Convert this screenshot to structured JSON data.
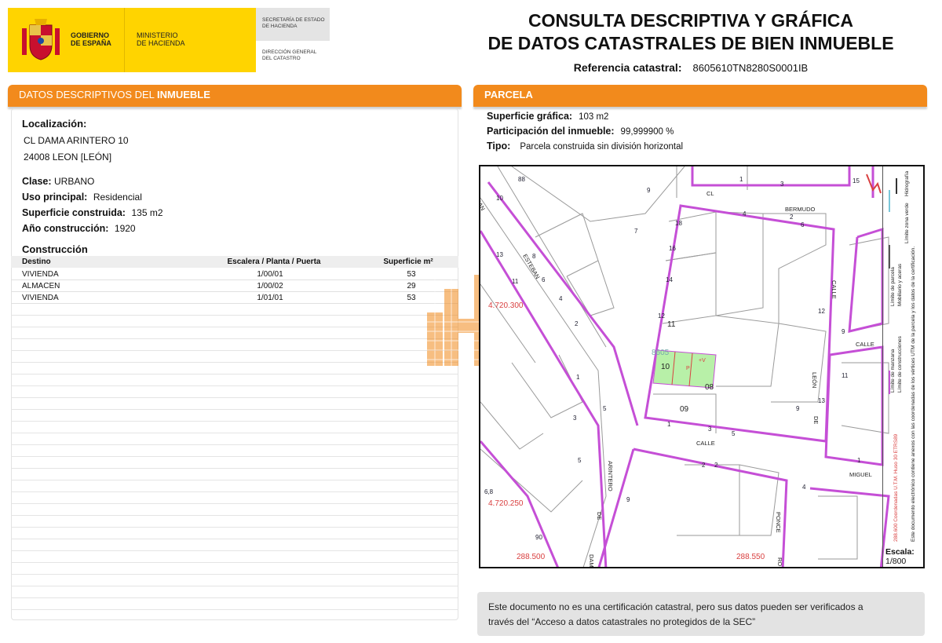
{
  "header": {
    "gobierno": [
      "GOBIERNO",
      "DE ESPAÑA"
    ],
    "ministerio": [
      "MINISTERIO",
      "DE HACIENDA"
    ],
    "secretaria": [
      "SECRETARÍA DE ESTADO",
      "DE HACIENDA"
    ],
    "direccion": [
      "DIRECCIÓN GENERAL",
      "DEL CATASTRO"
    ],
    "title_line1": "CONSULTA DESCRIPTIVA Y GRÁFICA",
    "title_line2": "DE DATOS CATASTRALES DE BIEN INMUEBLE",
    "ref_label": "Referencia catastral:",
    "ref_value": "8605610TN8280S0001IB"
  },
  "left": {
    "section_title_a": "DATOS DESCRIPTIVOS DEL ",
    "section_title_b": "INMUEBLE",
    "localizacion_label": "Localización:",
    "address_line1": "CL DAMA ARINTERO 10",
    "address_line2": "24008 LEON [LEÓN]",
    "clase_label": "Clase:",
    "clase_value": "URBANO",
    "uso_label": "Uso principal:",
    "uso_value": "Residencial",
    "superficie_label": "Superficie construida:",
    "superficie_value": "135 m2",
    "anio_label": "Año construcción:",
    "anio_value": "1920",
    "construccion_label": "Construcción",
    "table_headers": [
      "Destino",
      "Escalera / Planta / Puerta",
      "Superficie m²"
    ],
    "rows": [
      [
        "VIVIENDA",
        "1/00/01",
        "53"
      ],
      [
        "ALMACEN",
        "1/00/02",
        "29"
      ],
      [
        "VIVIENDA",
        "1/01/01",
        "53"
      ]
    ]
  },
  "right": {
    "section_title": "PARCELA",
    "superficie_grafica_label": "Superficie gráfica:",
    "superficie_grafica_value": "103 m2",
    "participacion_label": "Participación del inmueble:",
    "participacion_value": "99,999900 %",
    "tipo_label": "Tipo:",
    "tipo_value": "Parcela construida sin división horizontal",
    "escala_label": "Escala:",
    "escala_value": "1/800",
    "notice_line1": "Este documento no es una certificación catastral, pero sus datos pueden ser verificados a",
    "notice_line2": "través del “Acceso a datos catastrales no protegidos de la SEC”"
  },
  "map": {
    "coord_labels": [
      "4.720.300",
      "4.720.250",
      "288.500",
      "288.550"
    ],
    "street_labels": [
      "CL",
      "BERMUDO",
      "CALLE",
      "CALLE",
      "LEÓN",
      "DE",
      "CALLE",
      "MIGUEL",
      "ESTEBAN",
      "SAN",
      "ARINTERO",
      "DE",
      "DAMA",
      "PONCE",
      "RO"
    ],
    "parcel_labels": [
      "11",
      "10",
      "08",
      "09",
      "8605",
      "P",
      "+V"
    ],
    "vertex_numbers": [
      "1",
      "3",
      "5",
      "4",
      "6",
      "18",
      "16",
      "14",
      "12",
      "9",
      "7",
      "5",
      "3",
      "1",
      "2",
      "4",
      "6",
      "8",
      "10",
      "11",
      "13",
      "12",
      "9",
      "13",
      "11",
      "9",
      "15",
      "2",
      "4",
      "1",
      "3",
      "5",
      "2",
      "1",
      "9",
      "6,8",
      "90",
      "88",
      "2"
    ],
    "legend": [
      "Límite de manzana",
      "Límite de parcela",
      "Límite de construcciones",
      "Mobiliario y aceras",
      "Límite zona verde",
      "Hidrografía",
      "288.600 Coordenadas U.T.M. Huso 30 ETRS89",
      "Este documento electrónico contiene anexos con las coordenadas de los vértices UTM de la parcela y los datos de la certificación."
    ]
  },
  "colors": {
    "accent_orange": "#f28a1c",
    "logo_yellow": "#ffd400",
    "manzana_magenta": "#c54fd6",
    "parcel_green": "#b8f0a8",
    "coord_red": "#d94040"
  }
}
